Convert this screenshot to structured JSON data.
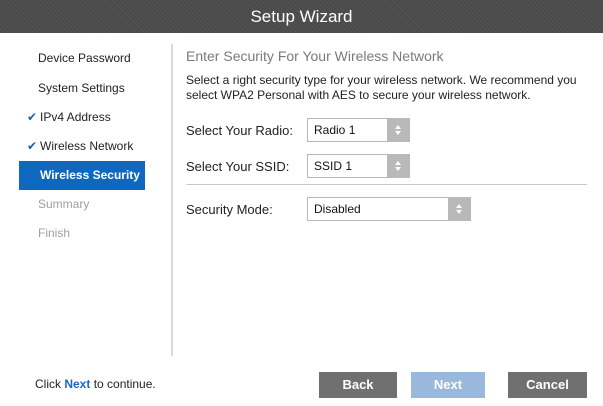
{
  "window": {
    "title": "Setup Wizard"
  },
  "sidebar": {
    "items": [
      {
        "label": "Device Password",
        "state": "normal"
      },
      {
        "label": "System Settings",
        "state": "normal"
      },
      {
        "label": "IPv4 Address",
        "state": "completed"
      },
      {
        "label": "Wireless Network",
        "state": "completed"
      },
      {
        "label": "Wireless Security",
        "state": "active"
      },
      {
        "label": "Summary",
        "state": "disabled"
      },
      {
        "label": "Finish",
        "state": "disabled"
      }
    ],
    "check_glyph": "✔"
  },
  "main": {
    "heading": "Enter Security For Your Wireless Network",
    "description": "Select a right security type for your wireless network. We recommend you select WPA2 Personal with AES to secure your wireless network.",
    "radio": {
      "label": "Select Your Radio:",
      "value": "Radio 1"
    },
    "ssid": {
      "label": "Select Your SSID:",
      "value": "SSID 1"
    },
    "security_mode": {
      "label": "Security Mode:",
      "value": "Disabled"
    }
  },
  "footer": {
    "prefix": "Click ",
    "link": "Next",
    "suffix": " to continue."
  },
  "buttons": {
    "back": "Back",
    "next": "Next",
    "cancel": "Cancel"
  },
  "colors": {
    "titlebar": "#4a4a4a",
    "active_item": "#0e68bf",
    "check": "#1a5fb4",
    "button": "#707070",
    "button_disabled": "#99b8dc"
  }
}
